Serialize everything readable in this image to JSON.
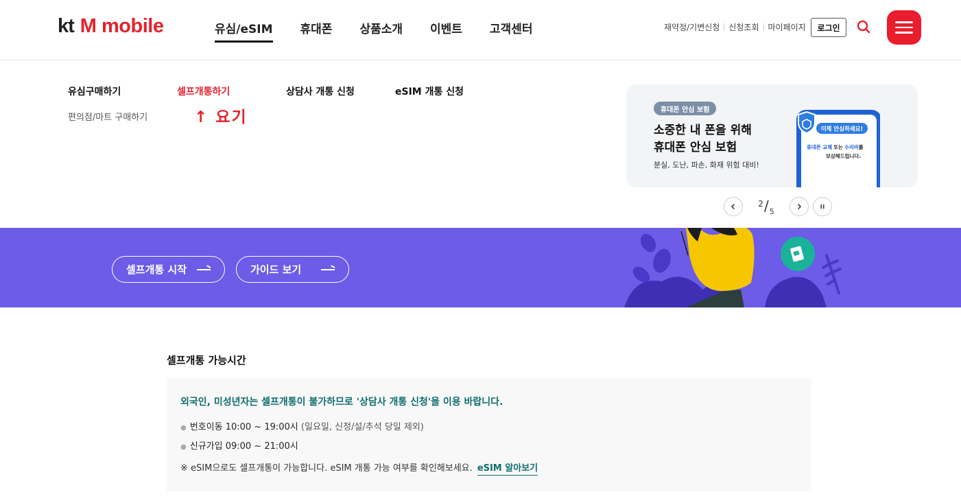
{
  "header": {
    "logo": {
      "kt": "kt",
      "brand": "M mobile"
    },
    "gnb": [
      {
        "label": "유심/eSIM",
        "active": true
      },
      {
        "label": "휴대폰"
      },
      {
        "label": "상품소개"
      },
      {
        "label": "이벤트"
      },
      {
        "label": "고객센터"
      }
    ],
    "util_links": [
      "재약정/기변신청",
      "신청조회",
      "마이페이지"
    ],
    "login_label": "로그인",
    "icons": {
      "search": "search-icon",
      "menu": "hamburger-menu-icon"
    },
    "accent_color": "#e4222e"
  },
  "mega_menu": {
    "items": [
      {
        "label": "유심구매하기",
        "sub": "편의점/마트 구매하기"
      },
      {
        "label": "셀프개통하기",
        "highlighted": true
      },
      {
        "label": "상담사 개통 신청"
      },
      {
        "label": "eSIM 개통 신청"
      }
    ],
    "annotation": "↑ 요기",
    "promo": {
      "badge": "휴대폰 안심 보험",
      "title_line1": "소중한 내 폰을 위해",
      "title_line2": "휴대폰 안심 보험",
      "desc": "분실, 도난, 파손, 화재 위험 대비!",
      "phone_screen": {
        "bubble": "이제 안심하세요!",
        "line1_a": "휴대폰 교체",
        "line1_b": "또는",
        "line1_c": "수리비",
        "line1_d": "를",
        "line2": "보상해드립니다."
      }
    },
    "pager": {
      "current": "2",
      "total": "5",
      "prev": "‹",
      "next": "›",
      "pause": "II"
    }
  },
  "hero": {
    "buttons": [
      {
        "label": "셀프개통 시작"
      },
      {
        "label": "가이드 보기"
      }
    ],
    "bg_color": "#6c5ce7"
  },
  "content": {
    "section_title": "셀프개통 가능시간",
    "notice": "외국인, 미성년자는 셀프개통이 불가하므로 '상담사 개통 신청'을 이용 바랍니다.",
    "hours": [
      {
        "label": "번호이동 10:00 ~ 19:00시",
        "note": "(일요일, 신정/설/추석 당일 제외)"
      },
      {
        "label": "신규가입 09:00 ~ 21:00시",
        "note": ""
      }
    ],
    "esim_note": "※ eSIM으로도 셀프개통이 가능합니다. eSIM 개통 가능 여부를 확인해보세요.",
    "esim_link": "eSIM 알아보기"
  }
}
